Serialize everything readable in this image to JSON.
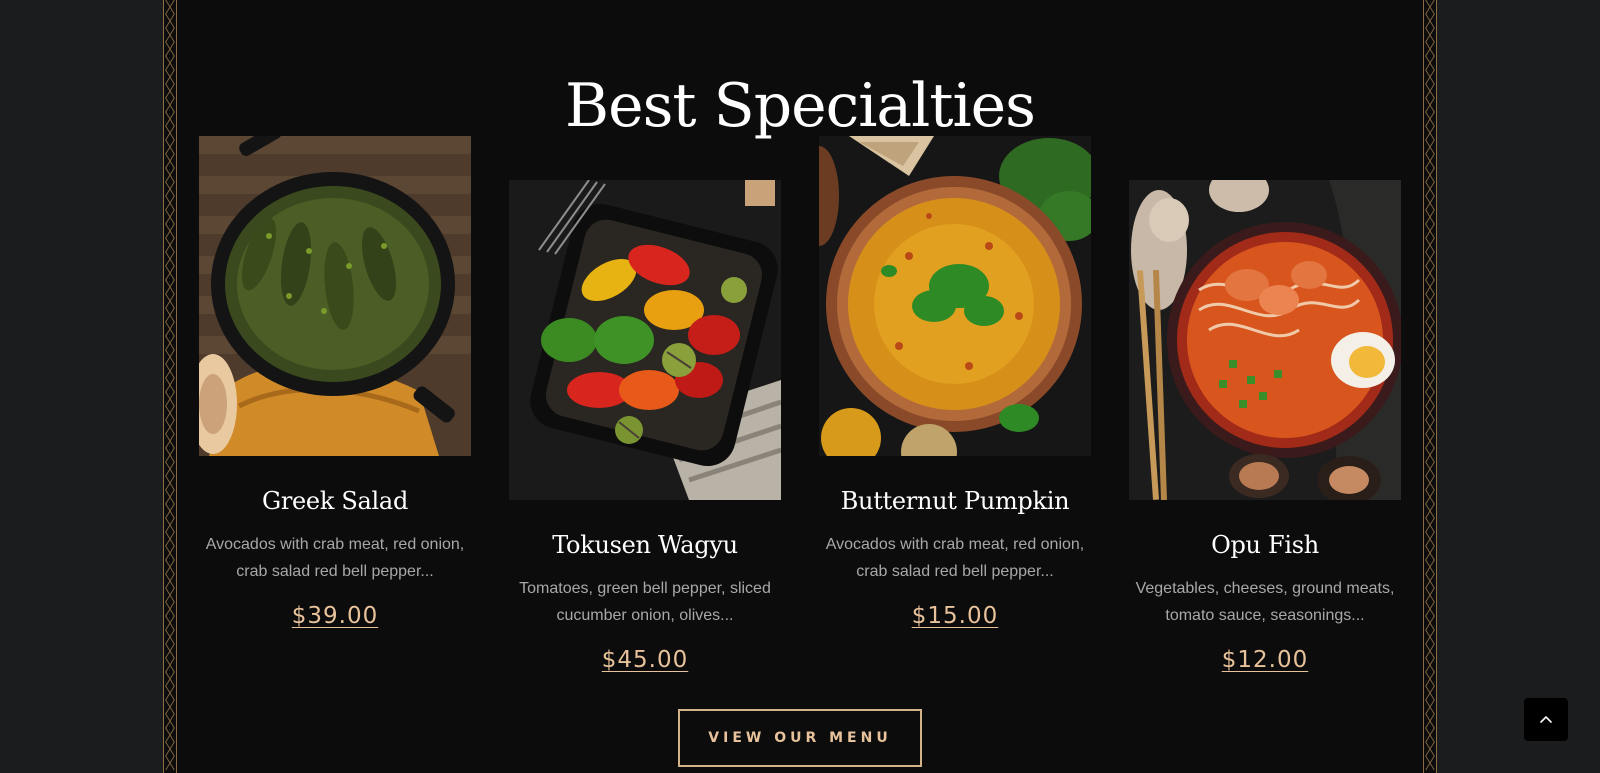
{
  "section": {
    "title": "Best Specialties"
  },
  "dishes": [
    {
      "name": "Greek Salad",
      "description": "Avocados with crab meat, red onion, crab salad red bell pepper...",
      "price": "$39.00"
    },
    {
      "name": "Tokusen Wagyu",
      "description": "Tomatoes, green bell pepper, sliced cucumber onion, olives...",
      "price": "$45.00"
    },
    {
      "name": "Butternut Pumpkin",
      "description": "Avocados with crab meat, red onion, crab salad red bell pepper...",
      "price": "$15.00"
    },
    {
      "name": "Opu Fish",
      "description": "Vegetables, cheeses, ground meats, tomato sauce, seasonings...",
      "price": "$12.00"
    }
  ],
  "cta": {
    "label": "VIEW OUR MENU"
  },
  "icons": {
    "scroll_top": "chevron-up-icon"
  },
  "colors": {
    "background": "#0c0c0c",
    "accent": "#e7c29a",
    "text": "#ffffff",
    "muted": "#a8a8a8"
  }
}
